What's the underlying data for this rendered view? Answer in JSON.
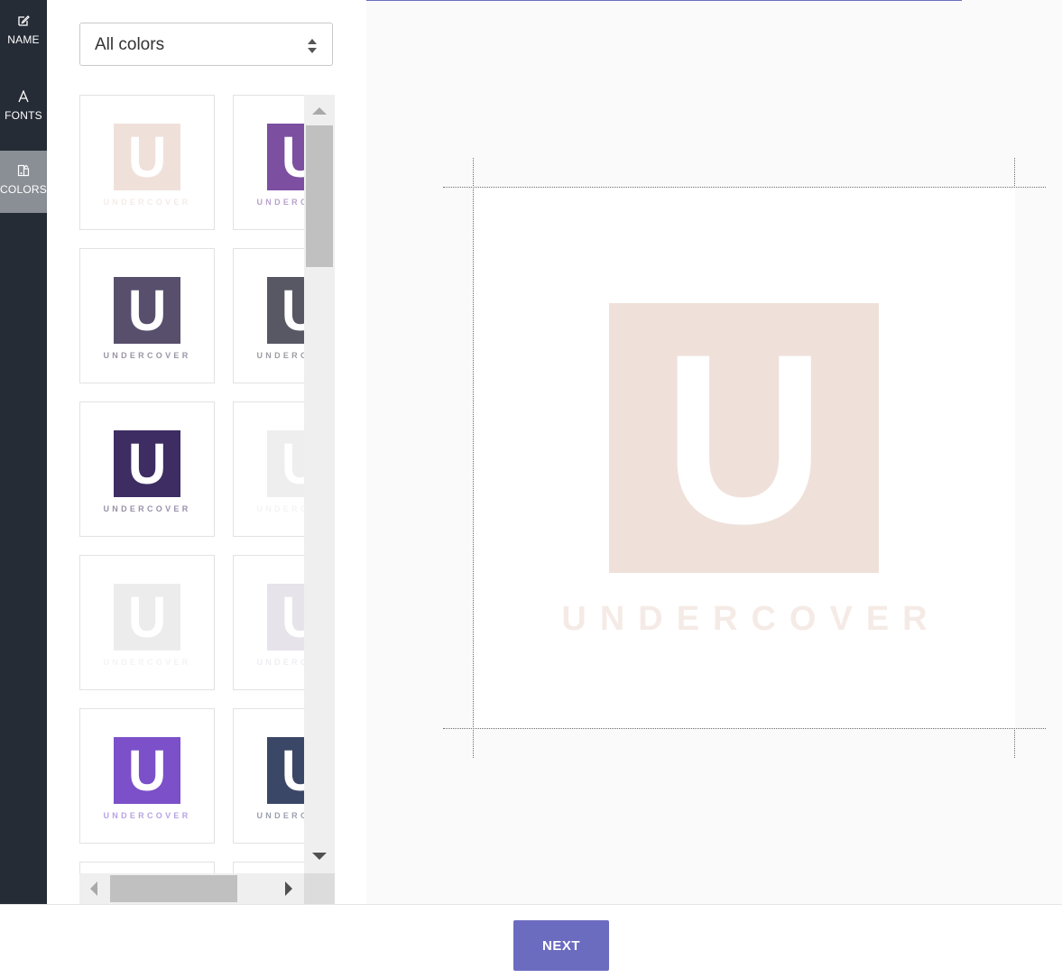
{
  "sidebar": {
    "items": [
      {
        "label": "NAME",
        "icon": "edit-icon"
      },
      {
        "label": "FONTS",
        "icon": "font-icon"
      },
      {
        "label": "COLORS",
        "icon": "palette-icon",
        "active": true
      }
    ]
  },
  "color_filter": {
    "selected": "All colors"
  },
  "logo": {
    "letter": "U",
    "wordmark": "UNDERCOVER"
  },
  "palettes": [
    {
      "square": "#efe1da",
      "text": "#f5ebe6"
    },
    {
      "square": "#7c4fa1",
      "text": "#b8a2cc"
    },
    {
      "square": "#574f6c",
      "text": "#9a95a5"
    },
    {
      "square": "#585865",
      "text": "#9c9ca4"
    },
    {
      "square": "#3d2d62",
      "text": "#9891a8"
    },
    {
      "square": "#eeeeee",
      "text": "#f4f4f4"
    },
    {
      "square": "#ececec",
      "text": "#f3f3f3"
    },
    {
      "square": "#e6e3ea",
      "text": "#efedf2"
    },
    {
      "square": "#7b50c9",
      "text": "#b8a2e2"
    },
    {
      "square": "#3b4766",
      "text": "#9aa0b0"
    },
    {
      "square": "#ececec",
      "text": "#f3f3f3"
    },
    {
      "square": "#ececec",
      "text": "#f3f3f3"
    }
  ],
  "preview": {
    "square_color": "#efe1da",
    "text_color": "#f5ebe6"
  },
  "footer": {
    "next_label": "NEXT"
  }
}
